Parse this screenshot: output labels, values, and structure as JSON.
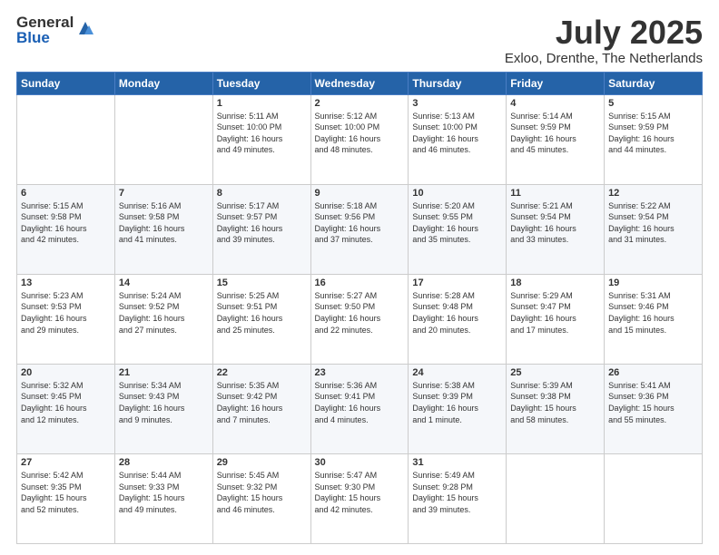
{
  "logo": {
    "general": "General",
    "blue": "Blue"
  },
  "header": {
    "month": "July 2025",
    "location": "Exloo, Drenthe, The Netherlands"
  },
  "weekdays": [
    "Sunday",
    "Monday",
    "Tuesday",
    "Wednesday",
    "Thursday",
    "Friday",
    "Saturday"
  ],
  "weeks": [
    [
      {
        "day": "",
        "info": ""
      },
      {
        "day": "",
        "info": ""
      },
      {
        "day": "1",
        "info": "Sunrise: 5:11 AM\nSunset: 10:00 PM\nDaylight: 16 hours\nand 49 minutes."
      },
      {
        "day": "2",
        "info": "Sunrise: 5:12 AM\nSunset: 10:00 PM\nDaylight: 16 hours\nand 48 minutes."
      },
      {
        "day": "3",
        "info": "Sunrise: 5:13 AM\nSunset: 10:00 PM\nDaylight: 16 hours\nand 46 minutes."
      },
      {
        "day": "4",
        "info": "Sunrise: 5:14 AM\nSunset: 9:59 PM\nDaylight: 16 hours\nand 45 minutes."
      },
      {
        "day": "5",
        "info": "Sunrise: 5:15 AM\nSunset: 9:59 PM\nDaylight: 16 hours\nand 44 minutes."
      }
    ],
    [
      {
        "day": "6",
        "info": "Sunrise: 5:15 AM\nSunset: 9:58 PM\nDaylight: 16 hours\nand 42 minutes."
      },
      {
        "day": "7",
        "info": "Sunrise: 5:16 AM\nSunset: 9:58 PM\nDaylight: 16 hours\nand 41 minutes."
      },
      {
        "day": "8",
        "info": "Sunrise: 5:17 AM\nSunset: 9:57 PM\nDaylight: 16 hours\nand 39 minutes."
      },
      {
        "day": "9",
        "info": "Sunrise: 5:18 AM\nSunset: 9:56 PM\nDaylight: 16 hours\nand 37 minutes."
      },
      {
        "day": "10",
        "info": "Sunrise: 5:20 AM\nSunset: 9:55 PM\nDaylight: 16 hours\nand 35 minutes."
      },
      {
        "day": "11",
        "info": "Sunrise: 5:21 AM\nSunset: 9:54 PM\nDaylight: 16 hours\nand 33 minutes."
      },
      {
        "day": "12",
        "info": "Sunrise: 5:22 AM\nSunset: 9:54 PM\nDaylight: 16 hours\nand 31 minutes."
      }
    ],
    [
      {
        "day": "13",
        "info": "Sunrise: 5:23 AM\nSunset: 9:53 PM\nDaylight: 16 hours\nand 29 minutes."
      },
      {
        "day": "14",
        "info": "Sunrise: 5:24 AM\nSunset: 9:52 PM\nDaylight: 16 hours\nand 27 minutes."
      },
      {
        "day": "15",
        "info": "Sunrise: 5:25 AM\nSunset: 9:51 PM\nDaylight: 16 hours\nand 25 minutes."
      },
      {
        "day": "16",
        "info": "Sunrise: 5:27 AM\nSunset: 9:50 PM\nDaylight: 16 hours\nand 22 minutes."
      },
      {
        "day": "17",
        "info": "Sunrise: 5:28 AM\nSunset: 9:48 PM\nDaylight: 16 hours\nand 20 minutes."
      },
      {
        "day": "18",
        "info": "Sunrise: 5:29 AM\nSunset: 9:47 PM\nDaylight: 16 hours\nand 17 minutes."
      },
      {
        "day": "19",
        "info": "Sunrise: 5:31 AM\nSunset: 9:46 PM\nDaylight: 16 hours\nand 15 minutes."
      }
    ],
    [
      {
        "day": "20",
        "info": "Sunrise: 5:32 AM\nSunset: 9:45 PM\nDaylight: 16 hours\nand 12 minutes."
      },
      {
        "day": "21",
        "info": "Sunrise: 5:34 AM\nSunset: 9:43 PM\nDaylight: 16 hours\nand 9 minutes."
      },
      {
        "day": "22",
        "info": "Sunrise: 5:35 AM\nSunset: 9:42 PM\nDaylight: 16 hours\nand 7 minutes."
      },
      {
        "day": "23",
        "info": "Sunrise: 5:36 AM\nSunset: 9:41 PM\nDaylight: 16 hours\nand 4 minutes."
      },
      {
        "day": "24",
        "info": "Sunrise: 5:38 AM\nSunset: 9:39 PM\nDaylight: 16 hours\nand 1 minute."
      },
      {
        "day": "25",
        "info": "Sunrise: 5:39 AM\nSunset: 9:38 PM\nDaylight: 15 hours\nand 58 minutes."
      },
      {
        "day": "26",
        "info": "Sunrise: 5:41 AM\nSunset: 9:36 PM\nDaylight: 15 hours\nand 55 minutes."
      }
    ],
    [
      {
        "day": "27",
        "info": "Sunrise: 5:42 AM\nSunset: 9:35 PM\nDaylight: 15 hours\nand 52 minutes."
      },
      {
        "day": "28",
        "info": "Sunrise: 5:44 AM\nSunset: 9:33 PM\nDaylight: 15 hours\nand 49 minutes."
      },
      {
        "day": "29",
        "info": "Sunrise: 5:45 AM\nSunset: 9:32 PM\nDaylight: 15 hours\nand 46 minutes."
      },
      {
        "day": "30",
        "info": "Sunrise: 5:47 AM\nSunset: 9:30 PM\nDaylight: 15 hours\nand 42 minutes."
      },
      {
        "day": "31",
        "info": "Sunrise: 5:49 AM\nSunset: 9:28 PM\nDaylight: 15 hours\nand 39 minutes."
      },
      {
        "day": "",
        "info": ""
      },
      {
        "day": "",
        "info": ""
      }
    ]
  ]
}
